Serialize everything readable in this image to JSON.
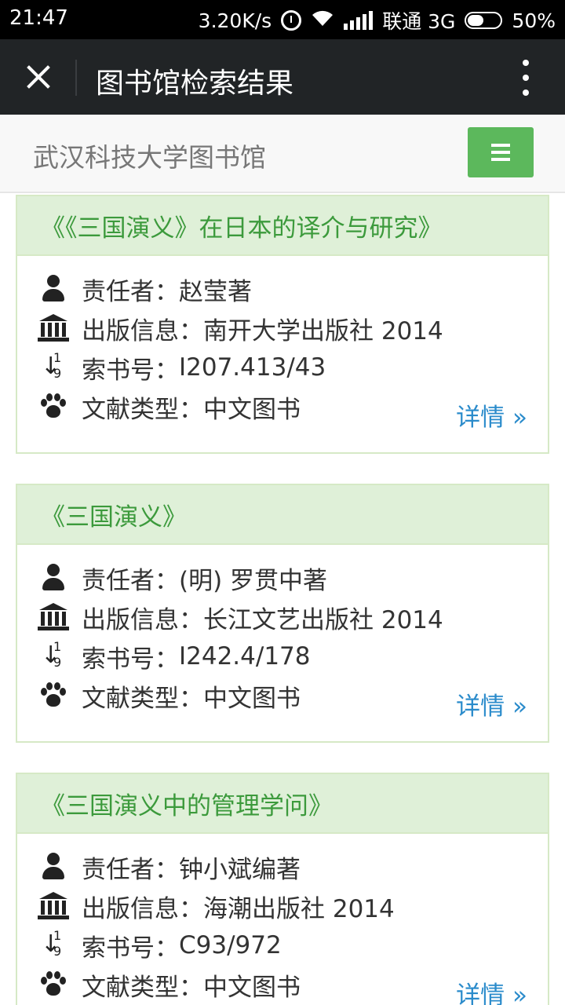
{
  "status_bar": {
    "time": "21:47",
    "speed": "3.20K/s",
    "carrier": "联通 3G",
    "battery": "50%",
    "battery_level": 0.5
  },
  "app_bar": {
    "title": "图书馆检索结果",
    "close_icon": "close-icon",
    "more_icon": "more-vert-icon"
  },
  "library": {
    "name": "武汉科技大学图书馆",
    "menu_icon": "hamburger-icon",
    "accent_color": "#5cb85c"
  },
  "labels": {
    "author": "责任者：",
    "publish": "出版信息：",
    "call_number": "索书号：",
    "doc_type": "文献类型：",
    "details": "详情 »"
  },
  "results": [
    {
      "title": "《《三国演义》在日本的译介与研究》",
      "author": "赵莹著",
      "publish": "南开大学出版社 2014",
      "call_number": "I207.413/43",
      "doc_type": "中文图书"
    },
    {
      "title": "《三国演义》",
      "author": "(明) 罗贯中著",
      "publish": "长江文艺出版社 2014",
      "call_number": "I242.4/178",
      "doc_type": "中文图书"
    },
    {
      "title": "《三国演义中的管理学问》",
      "author": "钟小斌编著",
      "publish": "海潮出版社 2014",
      "call_number": "C93/972",
      "doc_type": "中文图书"
    }
  ]
}
